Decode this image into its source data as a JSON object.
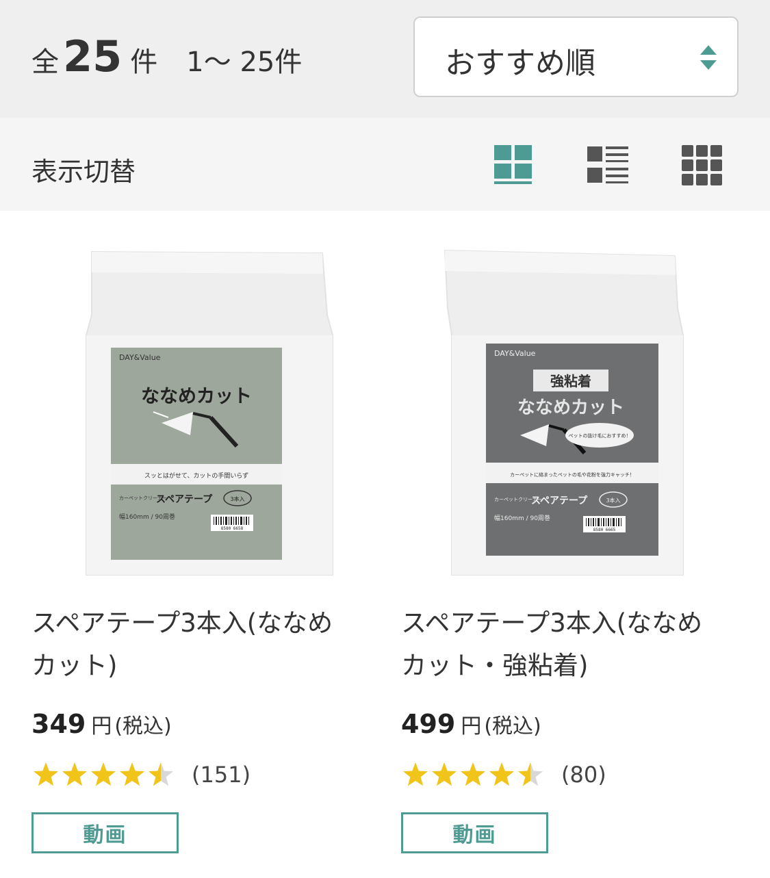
{
  "results": {
    "prefix": "全",
    "total": "25",
    "suffix": "件",
    "range": "1～ 25件"
  },
  "sort": {
    "selected": "おすすめ順",
    "icon": "sort-arrows-icon"
  },
  "view_switch": {
    "title": "表示切替",
    "active_color": "#4d9b92",
    "inactive_color": "#555555",
    "options": [
      {
        "icon": "grid-2col-icon",
        "active": true
      },
      {
        "icon": "list-view-icon",
        "active": false
      },
      {
        "icon": "grid-3col-icon",
        "active": false
      }
    ]
  },
  "products": [
    {
      "name": "スペアテープ3本入(ななめカット)",
      "price": "349",
      "yen": "円",
      "tax": "(税込)",
      "rating": 4.5,
      "reviews": "(151)",
      "video_label": "動画",
      "package": {
        "brand": "DAY&Value",
        "headline": "ななめカット",
        "tagline": "スッとはがせて、カットの手間いらず",
        "product": "スペアテープ",
        "category": "カーペットクリーナー",
        "qty": "3本入",
        "spec": "幅160mm / 90周巻",
        "barcode": "8580 6658",
        "label_color": "#9ea79c"
      }
    },
    {
      "name": "スペアテープ3本入(ななめカット・強粘着)",
      "price": "499",
      "yen": "円",
      "tax": "(税込)",
      "rating": 4.5,
      "reviews": "(80)",
      "video_label": "動画",
      "package": {
        "brand": "DAY&Value",
        "badge": "強粘着",
        "headline": "ななめカット",
        "bubble": "ペットの抜け毛におすすめ！",
        "tagline": "カーペットに絡まったペットの毛や花粉を強力キャッチ！",
        "product": "スペアテープ",
        "category": "カーペットクリーナー",
        "qty": "3本入",
        "spec": "幅160mm / 90周巻",
        "barcode": "8580 6665",
        "label_color": "#6d6f70"
      }
    }
  ],
  "colors": {
    "star": "#f0c419",
    "star_empty": "#d8d8d8",
    "accent": "#4d9b92"
  }
}
